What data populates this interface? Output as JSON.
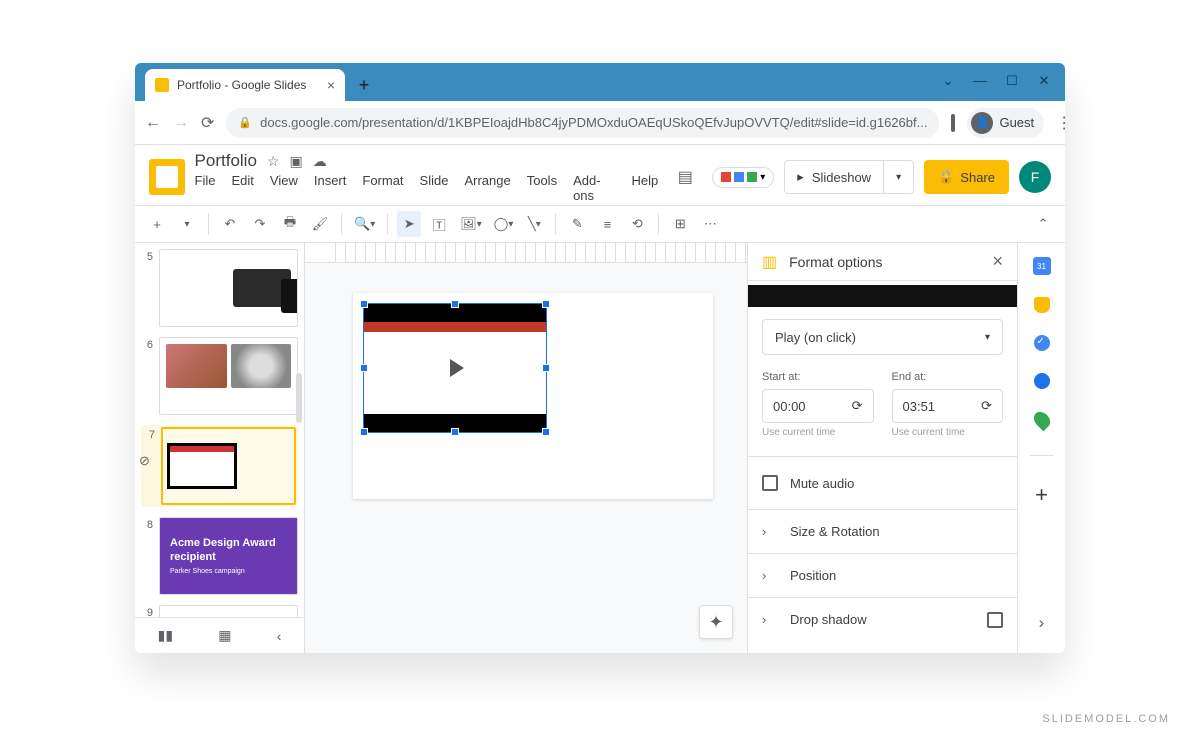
{
  "browser": {
    "tab_title": "Portfolio - Google Slides",
    "url": "docs.google.com/presentation/d/1KBPEIoajdHb8C4jyPDMOxduOAEqUSkoQEfvJupOVVTQ/edit#slide=id.g1626bf...",
    "guest_label": "Guest"
  },
  "app": {
    "doc_title": "Portfolio",
    "menus": {
      "file": "File",
      "edit": "Edit",
      "view": "View",
      "insert": "Insert",
      "format": "Format",
      "slide": "Slide",
      "arrange": "Arrange",
      "tools": "Tools",
      "addons": "Add-ons",
      "help": "Help"
    },
    "slideshow_label": "Slideshow",
    "share_label": "Share",
    "user_initial": "F"
  },
  "filmstrip": {
    "slides": [
      {
        "num": "5"
      },
      {
        "num": "6"
      },
      {
        "num": "7",
        "selected": true
      },
      {
        "num": "8",
        "title": "Acme Design Award recipient",
        "subtitle": "Parker Shoes campaign"
      },
      {
        "num": "9"
      }
    ]
  },
  "panel": {
    "title": "Format options",
    "play_mode": "Play (on click)",
    "start_label": "Start at:",
    "start_value": "00:00",
    "end_label": "End at:",
    "end_value": "03:51",
    "current_time_hint": "Use current time",
    "mute_label": "Mute audio",
    "section_size": "Size & Rotation",
    "section_position": "Position",
    "section_shadow": "Drop shadow"
  },
  "rail": {
    "calendar_day": "31"
  },
  "watermark": "SLIDEMODEL.COM"
}
